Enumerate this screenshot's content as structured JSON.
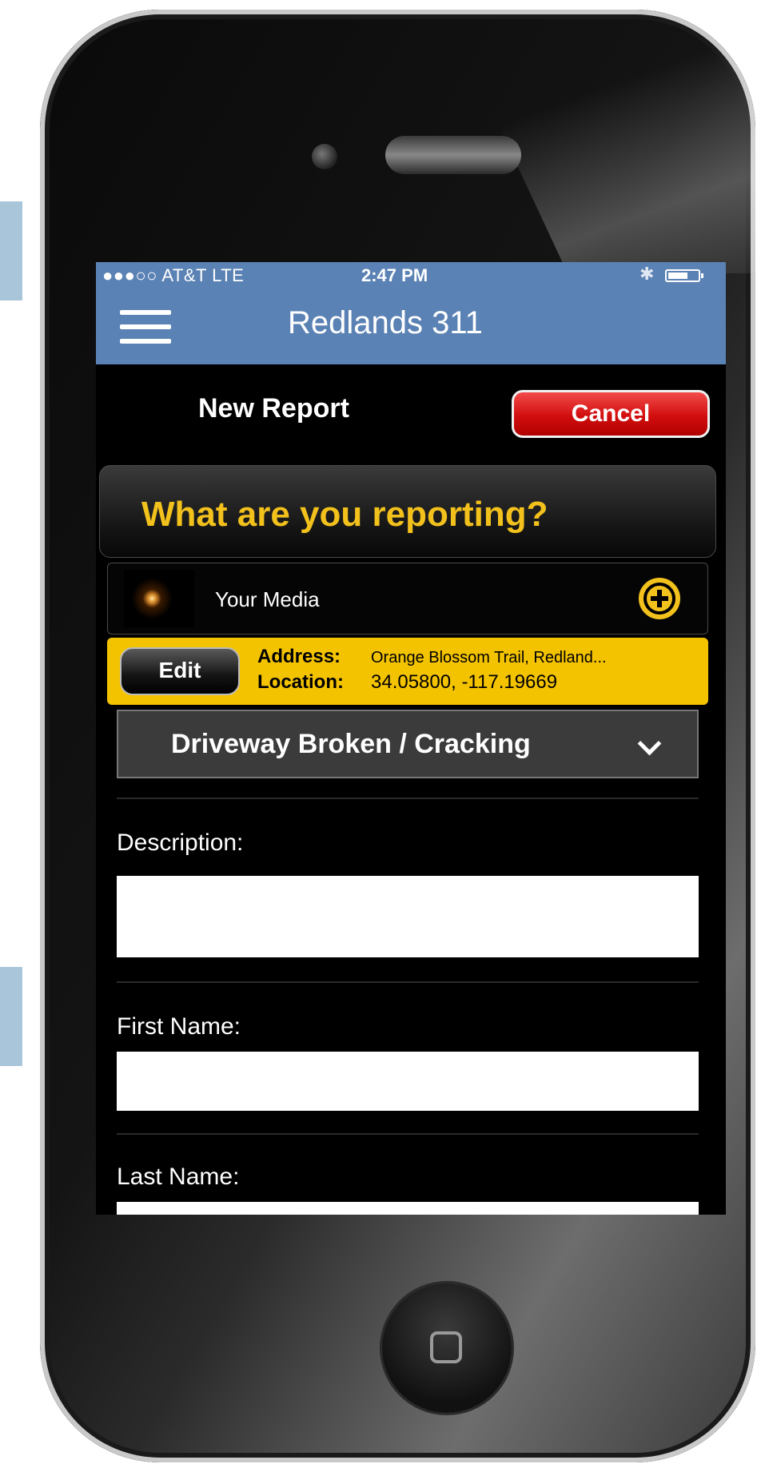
{
  "status": {
    "carrier": "●●●○○ AT&T  LTE",
    "time": "2:47 PM"
  },
  "nav": {
    "title": "Redlands 311"
  },
  "header": {
    "title": "New Report",
    "cancel_label": "Cancel"
  },
  "prompt": {
    "question": "What are you reporting?"
  },
  "media": {
    "label": "Your Media"
  },
  "location": {
    "edit_label": "Edit",
    "address_key": "Address:",
    "address_value": "Orange Blossom Trail, Redland...",
    "location_key": "Location:",
    "location_value": "34.05800, -117.19669"
  },
  "category": {
    "selected": "Driveway Broken / Cracking"
  },
  "form": {
    "description_label": "Description:",
    "first_name_label": "First Name:",
    "last_name_label": "Last Name:"
  },
  "colors": {
    "nav_bar": "#5b82b4",
    "accent_yellow": "#f2c11c",
    "cancel_red": "#d20e0e"
  }
}
